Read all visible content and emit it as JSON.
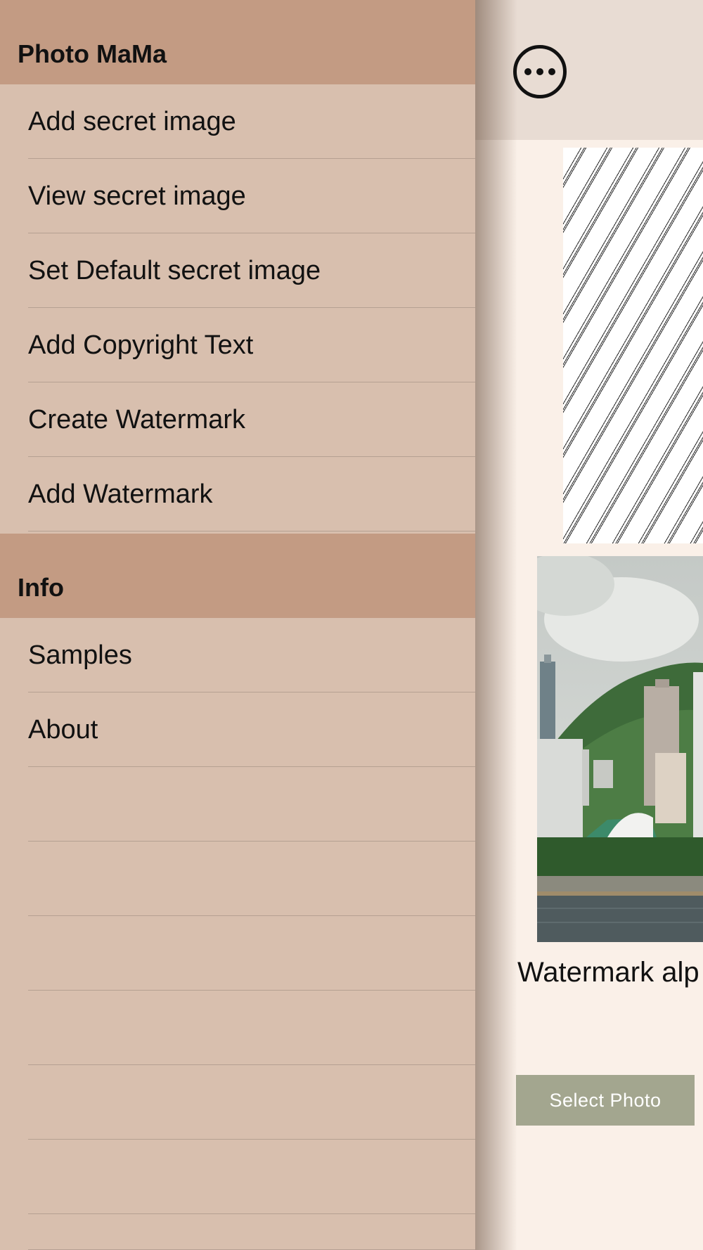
{
  "drawer": {
    "sections": [
      {
        "title": "Photo MaMa",
        "items": [
          {
            "label": "Add secret image"
          },
          {
            "label": "View secret image"
          },
          {
            "label": "Set Default secret image"
          },
          {
            "label": "Add Copyright Text"
          },
          {
            "label": "Create Watermark"
          },
          {
            "label": "Add Watermark"
          }
        ]
      },
      {
        "title": "Info",
        "items": [
          {
            "label": "Samples"
          },
          {
            "label": "About"
          },
          {
            "label": ""
          },
          {
            "label": ""
          },
          {
            "label": ""
          },
          {
            "label": ""
          },
          {
            "label": ""
          },
          {
            "label": ""
          },
          {
            "label": ""
          }
        ]
      }
    ]
  },
  "main": {
    "more_icon": "ellipsis-circle-icon",
    "alpha_label": "Watermark alp",
    "select_photo_label": "Select Photo"
  },
  "colors": {
    "drawer_background": "#d8bfae",
    "section_header": "#c39b83",
    "main_background": "#faf0e8",
    "main_header": "#e8dcd3",
    "button": "#a3a68f"
  }
}
